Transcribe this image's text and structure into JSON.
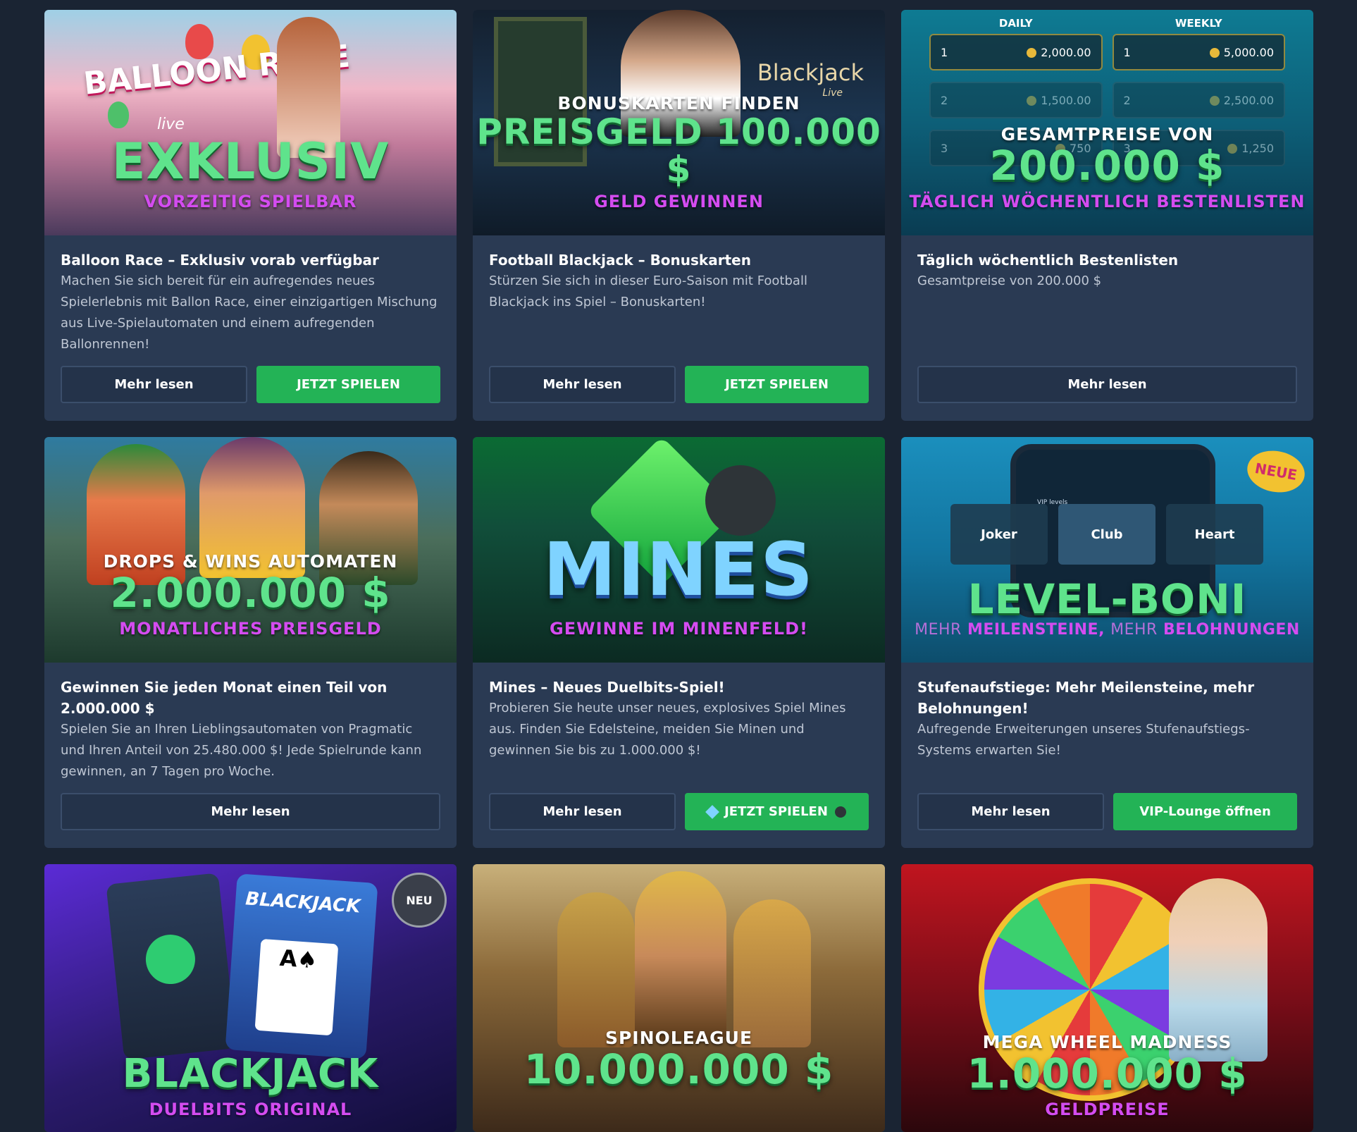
{
  "promotions": [
    {
      "banner": {
        "super": "",
        "big": "EXKLUSIV",
        "sub": "VORZEITIG SPIELBAR",
        "logo": "BALLOON RACE",
        "logo_sub": "live"
      },
      "title": "Balloon Race – Exklusiv vorab verfügbar",
      "desc": "Machen Sie sich bereit für ein aufregendes neues Spielerlebnis mit Ballon Race, einer einzigartigen Mischung aus Live-Spielautomaten und einem aufregenden Ballonrennen!",
      "buttons": [
        {
          "label": "Mehr lesen"
        },
        {
          "label": "JETZT SPIELEN"
        }
      ]
    },
    {
      "banner": {
        "super": "BONUSKARTEN FINDEN",
        "big": "PREISGELD 100.000 $",
        "sub": "GELD GEWINNEN",
        "logo": "Blackjack",
        "logo_sub": "Live"
      },
      "title": "Football Blackjack – Bonuskarten",
      "desc": "Stürzen Sie sich in dieser Euro-Saison mit Football Blackjack ins Spiel – Bonuskarten!",
      "buttons": [
        {
          "label": "Mehr lesen"
        },
        {
          "label": "JETZT SPIELEN"
        }
      ]
    },
    {
      "banner": {
        "super": "GESAMTPREISE VON",
        "big": "200.000 $",
        "sub": "TÄGLICH WÖCHENTLICH BESTENLISTEN",
        "daily_label": "DAILY",
        "weekly_label": "WEEKLY",
        "daily": [
          {
            "rank": "1",
            "amount": "2,000.00"
          },
          {
            "rank": "2",
            "amount": "1,500.00"
          },
          {
            "rank": "3",
            "amount": "750"
          }
        ],
        "weekly": [
          {
            "rank": "1",
            "amount": "5,000.00"
          },
          {
            "rank": "2",
            "amount": "2,500.00"
          },
          {
            "rank": "3",
            "amount": "1,250"
          }
        ]
      },
      "title": "Täglich wöchentlich Bestenlisten",
      "desc": "Gesamtpreise von 200.000 $",
      "buttons": [
        {
          "label": "Mehr lesen"
        }
      ]
    },
    {
      "banner": {
        "super": "DROPS & WINS AUTOMATEN",
        "big": "2.000.000 $",
        "sub": "MONATLICHES PREISGELD"
      },
      "title": "Gewinnen Sie jeden Monat einen Teil von 2.000.000 $",
      "desc": "Spielen Sie an Ihren Lieblingsautomaten von Pragmatic und Ihren Anteil von 25.480.000 $! Jede Spielrunde kann gewinnen, an 7 Tagen pro Woche.",
      "buttons": [
        {
          "label": "Mehr lesen"
        }
      ]
    },
    {
      "banner": {
        "super": "",
        "big": "MINES",
        "sub": "GEWINNE IM MINENFELD!"
      },
      "title": "Mines – Neues Duelbits-Spiel!",
      "desc": "Probieren Sie heute unser neues, explosives Spiel Mines aus. Finden Sie Edelsteine, meiden Sie Minen und gewinnen Sie bis zu 1.000.000 $!",
      "buttons": [
        {
          "label": "Mehr lesen"
        },
        {
          "label": "JETZT SPIELEN"
        }
      ]
    },
    {
      "banner": {
        "super": "",
        "big": "LEVEL-BONI",
        "sub_parts": [
          "MEHR",
          "MEILENSTEINE",
          "MEHR",
          "BELOHNUNGEN"
        ],
        "badge": "NEUE",
        "tiles": [
          "Joker",
          "Club",
          "Heart"
        ],
        "phone_label": "VIP levels"
      },
      "title": "Stufenaufstiege: Mehr Meilensteine, mehr Belohnungen!",
      "desc": "Aufregende Erweiterungen unseres Stufenaufstiegs-Systems erwarten Sie!",
      "buttons": [
        {
          "label": "Mehr lesen"
        },
        {
          "label": "VIP-Lounge öffnen"
        }
      ]
    },
    {
      "banner": {
        "super": "",
        "big": "BLACKJACK",
        "sub": "DUELBITS ORIGINAL",
        "badge": "NEU",
        "card_label": "BLACKJACK"
      }
    },
    {
      "banner": {
        "super": "SPINOLEAGUE",
        "big": "10.000.000 $",
        "sub": ""
      }
    },
    {
      "banner": {
        "super": "MEGA WHEEL MADNESS",
        "big": "1.000.000 $",
        "sub": "GELDPREISE"
      }
    }
  ],
  "colors": {
    "accent_green": "#23b356",
    "card_bg": "#2a3a53",
    "page_bg": "#1a2433",
    "magenta": "#d44cf0"
  }
}
